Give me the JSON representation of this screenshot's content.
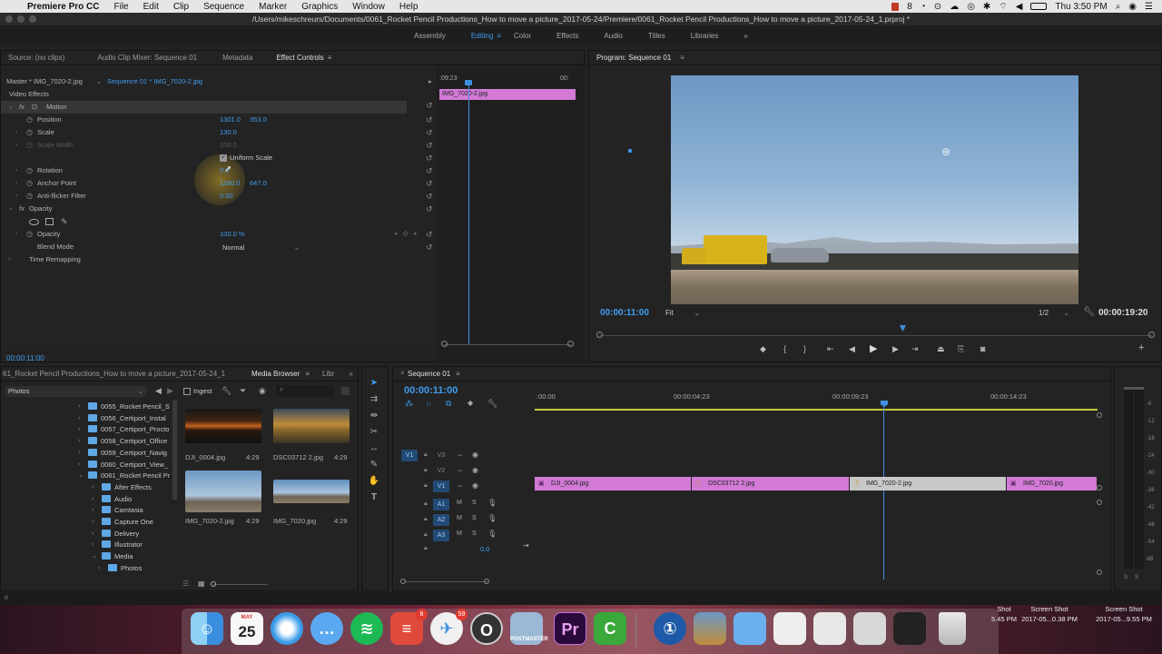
{
  "menubar": {
    "app": "Premiere Pro CC",
    "items": [
      "File",
      "Edit",
      "Clip",
      "Sequence",
      "Marker",
      "Graphics",
      "Window",
      "Help"
    ],
    "clock": "Thu 3:50 PM",
    "status_count": "8"
  },
  "path": "/Users/mikeschreurs/Documents/0061_Rocket Pencil Productions_How to move a picture_2017-05-24/Premiere/0061_Rocket Pencil Productions_How to move a picture_2017-05-24_1.prproj *",
  "workspaces": {
    "items": [
      "Assembly",
      "Editing",
      "Color",
      "Effects",
      "Audio",
      "Titles",
      "Libraries"
    ],
    "active": "Editing",
    "more": "»"
  },
  "source_tabs": [
    "Source: (no clips)",
    "Audio Clip Mixer: Sequence 01",
    "Metadata",
    "Effect Controls"
  ],
  "effect_controls": {
    "master": "Master * IMG_7020-2.jpg",
    "sequence": "Sequence 01 * IMG_7020-2.jpg",
    "section": "Video Effects",
    "mini_timecode_start": ":09:23",
    "mini_timecode_end": "00:",
    "mini_clip": "IMG_7020-2.jpg",
    "motion": "Motion",
    "position": {
      "label": "Position",
      "x": "1301.0",
      "y": "353.0"
    },
    "scale": {
      "label": "Scale",
      "value": "130.0"
    },
    "scale_width": {
      "label": "Scale Width",
      "value": "100.0"
    },
    "uniform_scale": "Uniform Scale",
    "rotation": {
      "label": "Rotation",
      "value": "0.0"
    },
    "anchor": {
      "label": "Anchor Point",
      "x": "1150.0",
      "y": "647.0"
    },
    "flicker": {
      "label": "Anti-flicker Filter",
      "value": "0.00"
    },
    "opacity_section": "Opacity",
    "opacity": {
      "label": "Opacity",
      "value": "100.0 %"
    },
    "blend": {
      "label": "Blend Mode",
      "value": "Normal"
    },
    "time_remap": "Time Remapping",
    "timecode": "00:00:11:00"
  },
  "program": {
    "title": "Program: Sequence 01",
    "timecode": "00:00:11:00",
    "fit": "Fit",
    "quality": "1/2",
    "duration": "00:00:19:20"
  },
  "project": {
    "title": "61_Rocket Pencil Productions_How to move a picture_2017-05-24_1",
    "tabs": [
      "Media Browser",
      "Libr"
    ],
    "location": "Photos",
    "ingest": "Ingest",
    "folders": [
      {
        "name": "0055_Rocket Pencil_S",
        "level": 0,
        "arrow": "›"
      },
      {
        "name": "0056_Certiport_Instal",
        "level": 0,
        "arrow": "›"
      },
      {
        "name": "0057_Certiport_Procto",
        "level": 0,
        "arrow": "›"
      },
      {
        "name": "0058_Certiport_Office",
        "level": 0,
        "arrow": "›"
      },
      {
        "name": "0059_Certiport_Navig",
        "level": 0,
        "arrow": "›"
      },
      {
        "name": "0060_Certiport_View_",
        "level": 0,
        "arrow": "›"
      },
      {
        "name": "0061_Rocket Pencil Pr",
        "level": 0,
        "arrow": "⌄"
      },
      {
        "name": "After Effects",
        "level": 1,
        "arrow": "›"
      },
      {
        "name": "Audio",
        "level": 1,
        "arrow": "›"
      },
      {
        "name": "Camtasia",
        "level": 1,
        "arrow": "›"
      },
      {
        "name": "Capture One",
        "level": 1,
        "arrow": "›"
      },
      {
        "name": "Delivery",
        "level": 1,
        "arrow": "›"
      },
      {
        "name": "Illustrator",
        "level": 1,
        "arrow": "›"
      },
      {
        "name": "Media",
        "level": 1,
        "arrow": "⌄"
      },
      {
        "name": "Photos",
        "level": 2,
        "arrow": "›"
      }
    ],
    "thumbs": [
      {
        "name": "DJI_0004.jpg",
        "dur": "4:29"
      },
      {
        "name": "DSC03712 2.jpg",
        "dur": "4:29"
      },
      {
        "name": "IMG_7020-2.jpg",
        "dur": "4:29"
      },
      {
        "name": "IMG_7020.jpg",
        "dur": "4:29"
      }
    ]
  },
  "timeline": {
    "title": "Sequence 01",
    "timecode": "00:00:11:00",
    "ruler": [
      ":00:00",
      "00:00:04:23",
      "00:00:09:23",
      "00:00:14:23"
    ],
    "video_tracks": [
      "V3",
      "V2",
      "V1"
    ],
    "audio_tracks": [
      "A1",
      "A2",
      "A3"
    ],
    "source_patch_v": "V1",
    "master_value": "0.0",
    "clips": [
      "DJI_0004.jpg",
      "DSC03712 2.jpg",
      "IMG_7020-2.jpg",
      "IMG_7020.jpg"
    ],
    "meter_labels": [
      "-6",
      "-12",
      "-18",
      "-24",
      "-30",
      "-36",
      "-42",
      "-48",
      "-54",
      "dB"
    ],
    "meter_solo": [
      "S",
      "S"
    ]
  },
  "dock": {
    "calendar_month": "MAY",
    "calendar_day": "25",
    "badge_todoist": "8",
    "badge_airmail": "59",
    "premiere_label": "Pr",
    "camtasia_label": "C",
    "postmaster_label": "POSTMASTER"
  },
  "desktop": [
    {
      "title": "Shot",
      "date": "5.45 PM"
    },
    {
      "title": "Screen Shot",
      "date": "2017-05...0.38 PM"
    },
    {
      "title": "Screen Shot",
      "date": "2017-05...9.55 PM"
    }
  ]
}
